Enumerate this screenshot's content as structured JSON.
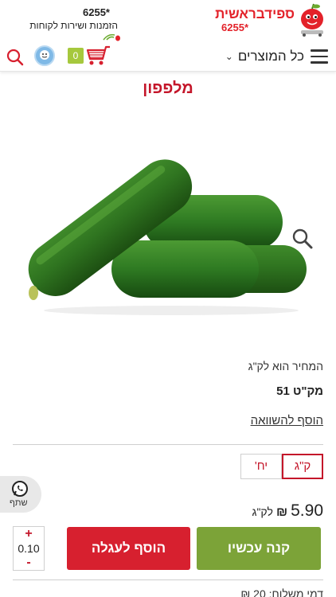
{
  "header": {
    "logo": {
      "brand_speed": "ספיד",
      "brand_rishon": "בראשית",
      "phone": "6255"
    },
    "service": {
      "phone": "6255*",
      "text": "הזמנות ושירות לקוחות"
    }
  },
  "navbar": {
    "all_products_label": "כל המוצרים",
    "cart_count": "0"
  },
  "product": {
    "title": "מלפפון",
    "price_unit_note": "המחיר הוא לק\"ג",
    "sku": "מק\"ט 51",
    "compare_label": "הוסף להשוואה",
    "units": [
      {
        "label": "ק\"ג",
        "active": true
      },
      {
        "label": "יח'",
        "active": false
      }
    ],
    "price": {
      "value": "5.90",
      "currency": "₪",
      "per": "לק\"ג"
    },
    "buy_now_label": "קנה עכשיו",
    "add_to_cart_label": "הוסף לעגלה",
    "quantity": {
      "plus": "+",
      "value": "0.10",
      "minus": "-"
    }
  },
  "share": {
    "label": "שתף"
  },
  "bottom_note": "דמי משלוח: 20 ₪",
  "colors": {
    "brand_red": "#d7202f",
    "title_red": "#c4162a",
    "buy_green": "#7ca338",
    "cart_count_green": "#a6c83d"
  },
  "icons": [
    "hamburger-icon",
    "chevron-down-icon",
    "search-icon",
    "avatar-icon",
    "cart-icon",
    "zoom-icon",
    "whatsapp-icon",
    "signal-icon"
  ]
}
